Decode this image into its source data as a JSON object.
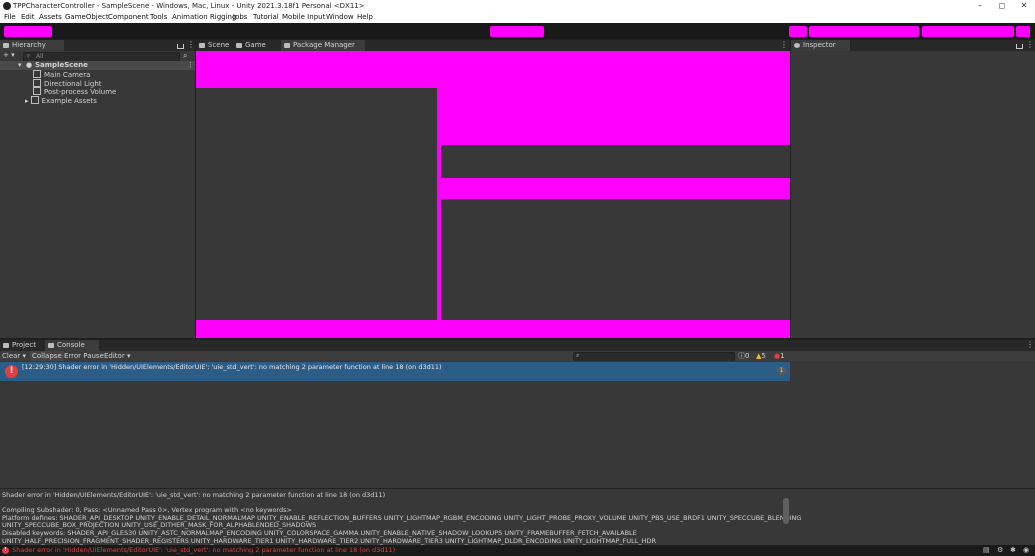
{
  "window": {
    "title": "TPPCharacterController - SampleScene - Windows, Mac, Linux - Unity 2021.3.18f1 Personal <DX11>",
    "controls": [
      "–",
      "◻",
      "✕"
    ]
  },
  "menu": [
    "File",
    "Edit",
    "Assets",
    "GameObject",
    "Component",
    "Tools",
    "Animation Rigging",
    "Jobs",
    "Tutorial",
    "Mobile Input",
    "Window",
    "Help"
  ],
  "hierarchy": {
    "tab_label": "Hierarchy",
    "add_label": "+ ▾",
    "search_placeholder": "All",
    "scene_name": "SampleScene",
    "items": [
      "Main Camera",
      "Directional Light",
      "Post-process Volume",
      "Example Assets"
    ]
  },
  "center_tabs": [
    "Scene",
    "Game",
    "Package Manager"
  ],
  "inspector": {
    "tab_label": "Inspector"
  },
  "bottom_tabs": [
    "Project",
    "Console"
  ],
  "console": {
    "buttons": [
      "Clear",
      "Collapse",
      "Error Pause",
      "Editor"
    ],
    "counts": {
      "logs": "0",
      "warnings": "5",
      "errors": "1"
    },
    "entry": {
      "text": "[12:29:30] Shader error in 'Hidden/UIElements/EditorUIE': 'uie_std_vert': no matching 2 parameter function at line 18 (on d3d11)",
      "count": "1"
    },
    "detail_lines": [
      "Shader error in 'Hidden/UIElements/EditorUIE': 'uie_std_vert': no matching 2 parameter function at line 18 (on d3d11)",
      "",
      "Compiling Subshader: 0, Pass: <Unnamed Pass 0>, Vertex program with <no keywords>",
      "Platform defines: SHADER_API_DESKTOP UNITY_ENABLE_DETAIL_NORMALMAP UNITY_ENABLE_REFLECTION_BUFFERS UNITY_LIGHTMAP_RGBM_ENCODING UNITY_LIGHT_PROBE_PROXY_VOLUME UNITY_PBS_USE_BRDF1 UNITY_SPECCUBE_BLENDING",
      "UNITY_SPECCUBE_BOX_PROJECTION UNITY_USE_DITHER_MASK_FOR_ALPHABLENDED_SHADOWS",
      "Disabled keywords: SHADER_API_GLES30 UNITY_ASTC_NORMALMAP_ENCODING UNITY_COLORSPACE_GAMMA UNITY_ENABLE_NATIVE_SHADOW_LOOKUPS UNITY_FRAMEBUFFER_FETCH_AVAILABLE",
      "UNITY_HALF_PRECISION_FRAGMENT_SHADER_REGISTERS UNITY_HARDWARE_TIER1 UNITY_HARDWARE_TIER2 UNITY_HARDWARE_TIER3 UNITY_LIGHTMAP_DLDR_ENCODING UNITY_LIGHTMAP_FULL_HDR"
    ]
  },
  "status_bar": {
    "message": "Shader error in 'Hidden/UIElements/EditorUIE': 'uie_std_vert': no matching 2 parameter function at line 18 (on d3d11)"
  },
  "colors": {
    "error_fill": "#ff00ff",
    "selection": "#2c5d87",
    "error_text": "#e04040"
  }
}
